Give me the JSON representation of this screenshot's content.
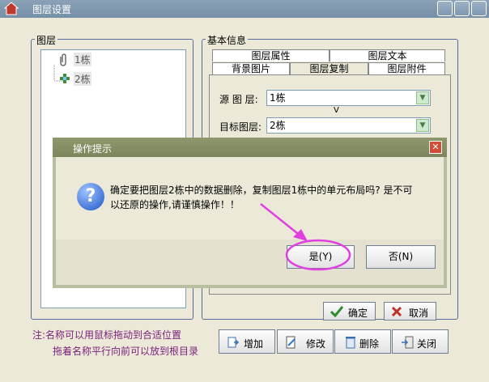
{
  "window": {
    "title": "图层设置"
  },
  "layers_group": {
    "label": "图层",
    "items": [
      "1栋",
      "2栋"
    ]
  },
  "info_group": {
    "label": "基本信息",
    "tabs_row1": [
      "图层属性",
      "图层文本"
    ],
    "tabs_row2": [
      "背景图片",
      "图层复制",
      "图层附件"
    ],
    "active_tab": "图层复制",
    "source_label": "源 图 层:",
    "source_value": "1栋",
    "arrow_label": "V",
    "target_label": "目标图层:",
    "target_value": "2栋"
  },
  "footer": {
    "ok_label": "确定",
    "cancel_label": "取消",
    "note_line1": "注:名称可以用鼠标拖动到合适位置",
    "note_line2": "拖着名称平行向前可以放到根目录",
    "add_label": "增加",
    "edit_label": "修改",
    "delete_label": "删除",
    "close_label": "关闭"
  },
  "dialog": {
    "title": "操作提示",
    "message_line1": "确定要把图层2栋中的数据删除，复制图层1栋中的单元布局吗? 是不可",
    "message_line2": "以还原的操作,请谨慎操作！！",
    "yes_label": "是(Y)",
    "no_label": "否(N)"
  },
  "colors": {
    "annotation": "#e040e0",
    "note_text": "#7a1f7a"
  },
  "icons": [
    "app-icon",
    "paperclip-icon",
    "layer-icon",
    "question-icon",
    "check-icon",
    "cross-icon",
    "add-icon",
    "edit-icon",
    "delete-icon",
    "close-icon"
  ]
}
